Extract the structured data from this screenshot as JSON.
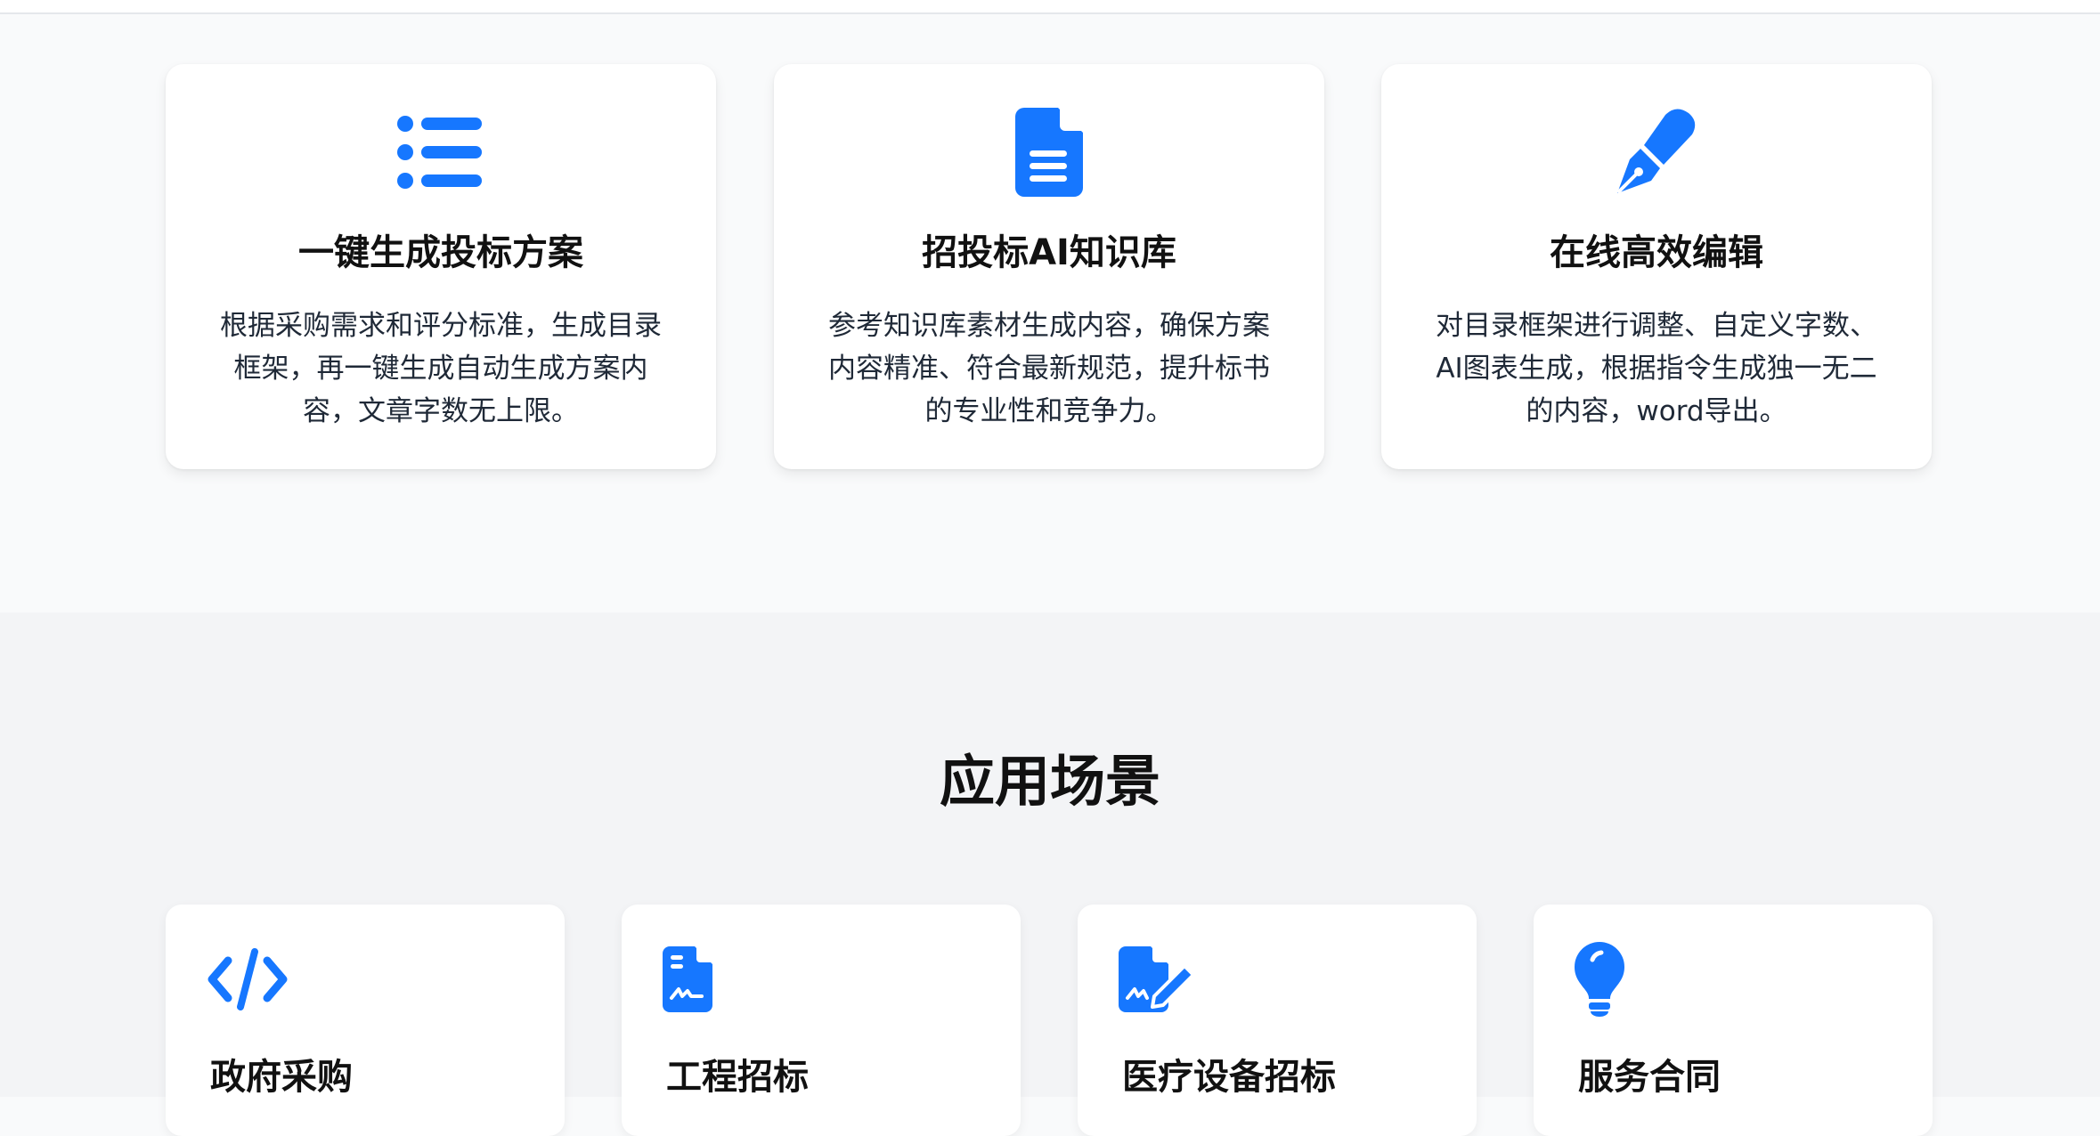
{
  "accent_color": "#1677ff",
  "features": [
    {
      "icon": "list-icon",
      "title": "一键生成投标方案",
      "desc": "根据采购需求和评分标准，生成目录框架，再一键生成自动生成方案内容，文章字数无上限。"
    },
    {
      "icon": "document-icon",
      "title": "招投标AI知识库",
      "desc": "参考知识库素材生成内容，确保方案内容精准、符合最新规范，提升标书的专业性和竞争力。"
    },
    {
      "icon": "pen-icon",
      "title": "在线高效编辑",
      "desc": "对目录框架进行调整、自定义字数、AI图表生成，根据指令生成独一无二的内容，word导出。"
    }
  ],
  "scenes": {
    "title": "应用场景",
    "items": [
      {
        "icon": "code-icon",
        "title": "政府采购"
      },
      {
        "icon": "signed-document-icon",
        "title": "工程招标"
      },
      {
        "icon": "document-pen-icon",
        "title": "医疗设备招标"
      },
      {
        "icon": "lightbulb-icon",
        "title": "服务合同"
      }
    ]
  }
}
